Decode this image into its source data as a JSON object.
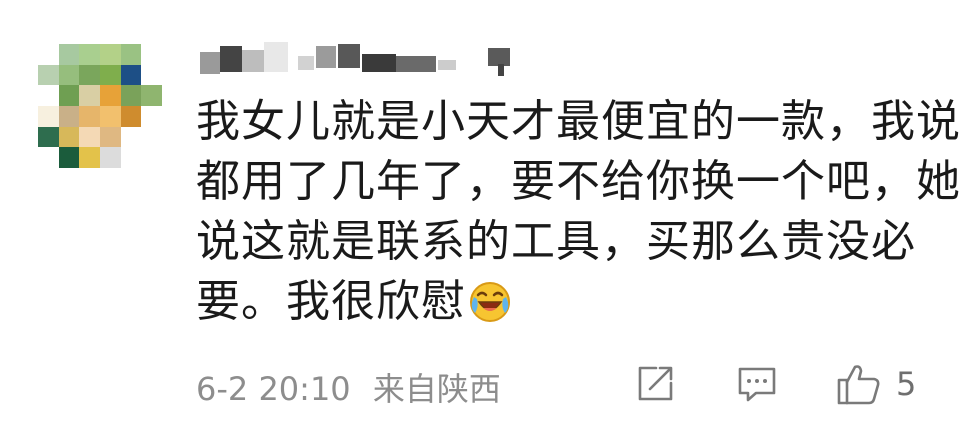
{
  "comment": {
    "avatar": {
      "pixelated": true,
      "mosaic_colors": [
        [
          "#ffffff",
          "#a7c9a0",
          "#a9cf8f",
          "#b3d188",
          "#9ac283",
          "#ffffff"
        ],
        [
          "#b8d0b0",
          "#96be7d",
          "#7aa65c",
          "#7fae4c",
          "#1d4f86",
          "#ffffff"
        ],
        [
          "#ffffff",
          "#6f9f52",
          "#d9cfa4",
          "#e7a238",
          "#7aa25a",
          "#8fb56f"
        ],
        [
          "#f7f0df",
          "#c9b088",
          "#e6b56a",
          "#f2c06d",
          "#cf8c2e",
          "#ffffff"
        ],
        [
          "#2e6d4e",
          "#d7b85a",
          "#f4d9b5",
          "#dfb882",
          "#ffffff",
          "#ffffff"
        ],
        [
          "#ffffff",
          "#1b5c3c",
          "#e3c24a",
          "#dcdcdc",
          "#ffffff",
          "#ffffff"
        ]
      ]
    },
    "username": {
      "pixelated": true
    },
    "text_lines": [
      "我女儿就是小天才最便宜的一款，我说",
      "都用了几年了，要不给你换一个吧，她",
      "说这就是联系的工具，买那么贵没必",
      "要。我很欣慰"
    ],
    "emoji_icon": "laughing-crying-emoji",
    "date": "6-2 20:10",
    "location": "来自陕西",
    "like_count": "5"
  },
  "icons": {
    "share": "share-icon",
    "reply": "comment-icon",
    "like": "thumbs-up-icon"
  },
  "colors": {
    "text": "#1a1a1a",
    "meta": "#8d8d8d",
    "icon": "#7a7a7a"
  }
}
